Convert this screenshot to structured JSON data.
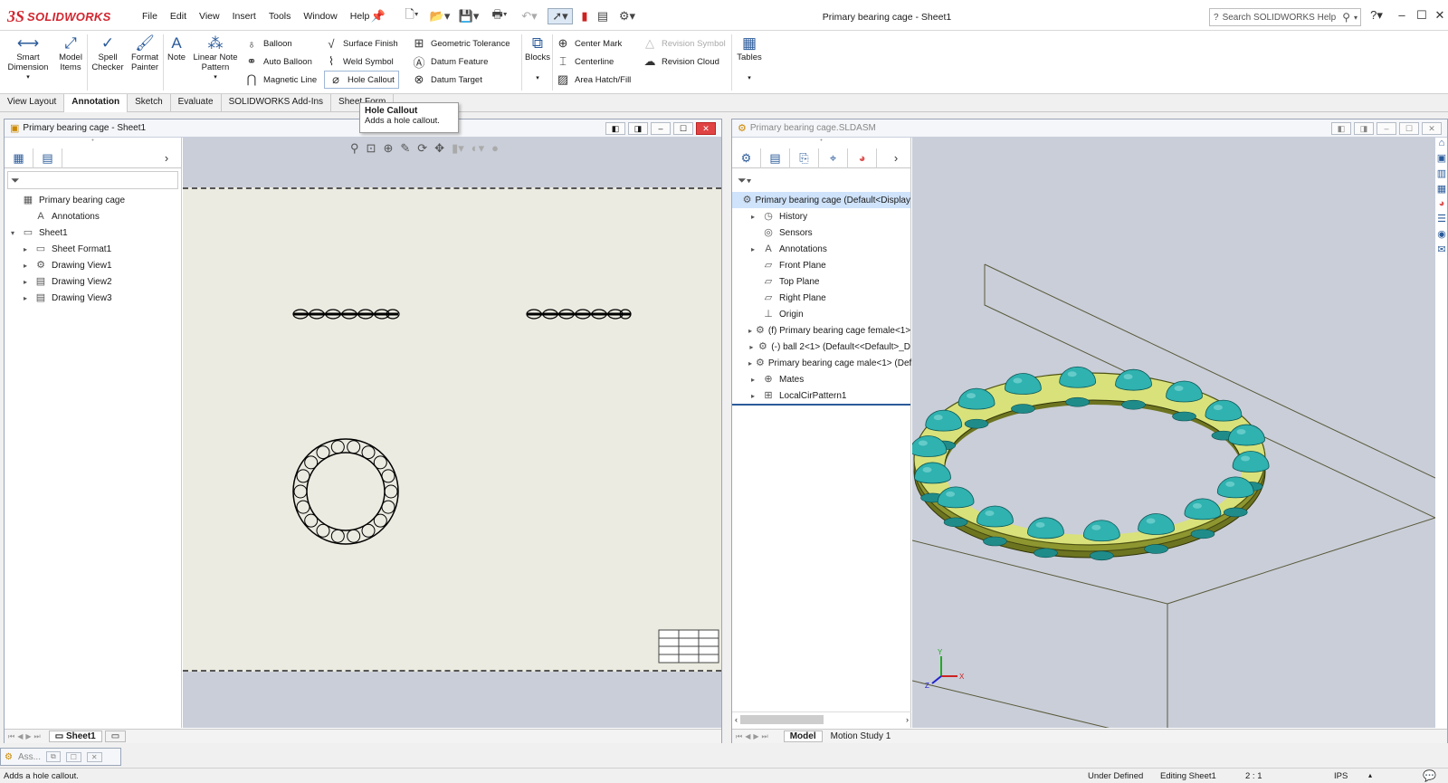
{
  "app": {
    "brand_ds": "3S",
    "brand_name": "SOLIDWORKS",
    "doc_title": "Primary bearing cage - Sheet1",
    "search_placeholder": "Search SOLIDWORKS Help"
  },
  "menu": [
    "File",
    "Edit",
    "View",
    "Insert",
    "Tools",
    "Window",
    "Help"
  ],
  "ribbon": {
    "smart_dimension": "Smart Dimension",
    "model_items": "Model Items",
    "spell_checker": "Spell Checker",
    "format_painter": "Format Painter",
    "note": "Note",
    "linear_note_pattern": "Linear Note Pattern",
    "balloon": "Balloon",
    "auto_balloon": "Auto Balloon",
    "magnetic_line": "Magnetic Line",
    "surface_finish": "Surface Finish",
    "weld_symbol": "Weld Symbol",
    "hole_callout": "Hole Callout",
    "geometric_tolerance": "Geometric Tolerance",
    "datum_feature": "Datum Feature",
    "datum_target": "Datum Target",
    "blocks": "Blocks",
    "center_mark": "Center Mark",
    "centerline": "Centerline",
    "area_hatch": "Area Hatch/Fill",
    "revision_symbol": "Revision Symbol",
    "revision_cloud": "Revision Cloud",
    "tables": "Tables"
  },
  "tabs": [
    "View Layout",
    "Annotation",
    "Sketch",
    "Evaluate",
    "SOLIDWORKS Add-Ins",
    "Sheet Form"
  ],
  "tooltip": {
    "title": "Hole Callout",
    "desc": "Adds a hole callout."
  },
  "left_window": {
    "title": "Primary bearing cage - Sheet1",
    "tree": [
      {
        "label": "Primary bearing cage",
        "indent": 0,
        "icon": "▦",
        "exp": ""
      },
      {
        "label": "Annotations",
        "indent": 1,
        "icon": "A",
        "exp": ""
      },
      {
        "label": "Sheet1",
        "indent": 0,
        "icon": "▭",
        "exp": "▾"
      },
      {
        "label": "Sheet Format1",
        "indent": 1,
        "icon": "▭",
        "exp": "▸"
      },
      {
        "label": "Drawing View1",
        "indent": 1,
        "icon": "⚙",
        "exp": "▸"
      },
      {
        "label": "Drawing View2",
        "indent": 1,
        "icon": "▤",
        "exp": "▸"
      },
      {
        "label": "Drawing View3",
        "indent": 1,
        "icon": "▤",
        "exp": "▸"
      }
    ],
    "sheet_tab": "Sheet1"
  },
  "right_window": {
    "title": "Primary bearing cage.SLDASM",
    "tree": [
      {
        "label": "Primary bearing cage  (Default<Display",
        "exp": "",
        "icon": "⚙",
        "selected": true,
        "indent": 0
      },
      {
        "label": "History",
        "exp": "▸",
        "icon": "◷",
        "indent": 1
      },
      {
        "label": "Sensors",
        "exp": "",
        "icon": "◎",
        "indent": 1
      },
      {
        "label": "Annotations",
        "exp": "▸",
        "icon": "A",
        "indent": 1
      },
      {
        "label": "Front Plane",
        "exp": "",
        "icon": "▱",
        "indent": 1
      },
      {
        "label": "Top Plane",
        "exp": "",
        "icon": "▱",
        "indent": 1
      },
      {
        "label": "Right Plane",
        "exp": "",
        "icon": "▱",
        "indent": 1
      },
      {
        "label": "Origin",
        "exp": "",
        "icon": "⊥",
        "indent": 1
      },
      {
        "label": "(f) Primary bearing cage female<1>",
        "exp": "▸",
        "icon": "⚙",
        "indent": 1
      },
      {
        "label": "(-) ball 2<1> (Default<<Default>_D",
        "exp": "▸",
        "icon": "⚙",
        "indent": 1
      },
      {
        "label": "Primary bearing cage male<1> (Def",
        "exp": "▸",
        "icon": "⚙",
        "indent": 1
      },
      {
        "label": "Mates",
        "exp": "▸",
        "icon": "⊕",
        "indent": 1
      },
      {
        "label": "LocalCirPattern1",
        "exp": "▸",
        "icon": "⊞",
        "indent": 1
      }
    ],
    "bottom_tabs": [
      "Model",
      "Motion Study 1"
    ]
  },
  "taskbar_item": "Ass...",
  "status": {
    "message": "Adds a hole callout.",
    "state": "Under Defined",
    "editing": "Editing Sheet1",
    "scale": "2 : 1",
    "units": "IPS"
  },
  "colors": {
    "cage": "#d9e27a",
    "ball": "#2fb2b0",
    "sheet": "#ecebe1",
    "viewport": "#c9ced9"
  }
}
